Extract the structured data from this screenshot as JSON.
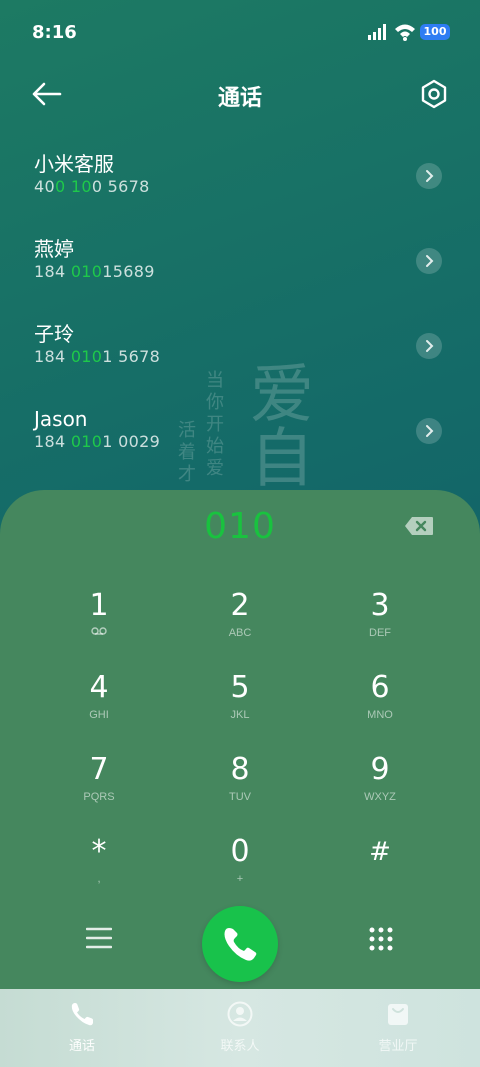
{
  "status_bar": {
    "time": "8:16",
    "battery": "100"
  },
  "header": {
    "title": "通话"
  },
  "contacts": [
    {
      "name": "小米客服",
      "number_parts": [
        "40",
        "0",
        " ",
        "10",
        "0 5678"
      ]
    },
    {
      "name": "燕婷",
      "number_parts": [
        "184 ",
        "010",
        "15689"
      ]
    },
    {
      "name": "子玲",
      "number_parts": [
        "184 ",
        "010",
        "1 5678"
      ]
    },
    {
      "name": "Jason",
      "number_parts": [
        "184 ",
        "010",
        "1 0029"
      ]
    }
  ],
  "dialer": {
    "input": "010",
    "keys": [
      {
        "digit": "1",
        "sub": ""
      },
      {
        "digit": "2",
        "sub": "ABC"
      },
      {
        "digit": "3",
        "sub": "DEF"
      },
      {
        "digit": "4",
        "sub": "GHI"
      },
      {
        "digit": "5",
        "sub": "JKL"
      },
      {
        "digit": "6",
        "sub": "MNO"
      },
      {
        "digit": "7",
        "sub": "PQRS"
      },
      {
        "digit": "8",
        "sub": "TUV"
      },
      {
        "digit": "9",
        "sub": "WXYZ"
      },
      {
        "digit": "*",
        "sub": ","
      },
      {
        "digit": "0",
        "sub": "+"
      },
      {
        "digit": "#",
        "sub": ""
      }
    ]
  },
  "decoration_text": {
    "col1": "当你开始爱",
    "col2": "活着才",
    "large": "爱自"
  },
  "tabs": [
    {
      "label": "通话",
      "icon": "phone-icon",
      "active": true
    },
    {
      "label": "联系人",
      "icon": "person-icon",
      "active": false
    },
    {
      "label": "营业厅",
      "icon": "bag-icon",
      "active": false
    }
  ],
  "colors": {
    "accent_green": "#1ec94a",
    "dial_panel": "#45875e",
    "call_button": "#18c24b",
    "battery": "#2f7df3"
  }
}
